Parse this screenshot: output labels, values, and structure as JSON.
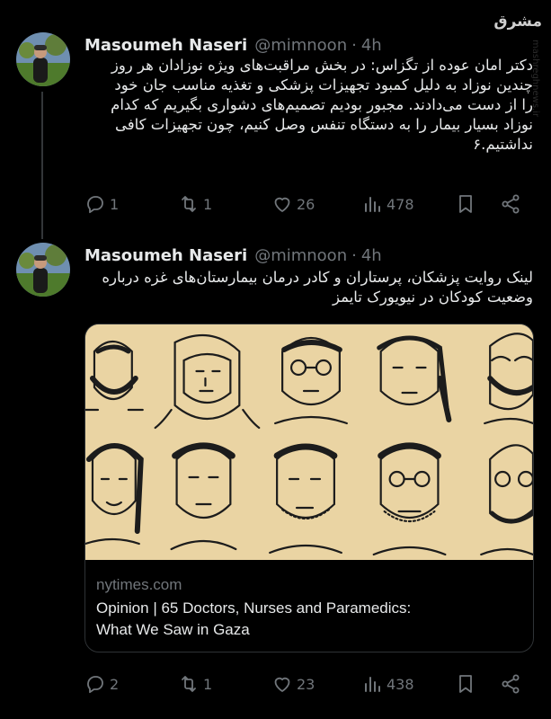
{
  "watermark": {
    "brand": "مشرق",
    "site": "mashreghnews.ir"
  },
  "tweets": [
    {
      "name": "Masoumeh Naseri",
      "handle": "@mimnoon",
      "dot": "·",
      "time": "4h",
      "lines": [
        "دکتر امان عوده از تگزاس: در بخش مراقبت‌های ویژه نوزادان هر روز",
        "چندین نوزاد به دلیل کمبود تجهیزات پزشکی و تغذیه مناسب جان خود",
        "را از دست می‌دادند. مجبور بودیم تصمیم‌های دشواری بگیریم که کدام",
        "نوزاد بسیار بیمار را به دستگاه تنفس وصل کنیم، چون تجهیزات کافی",
        "نداشتیم.۶"
      ],
      "reply_count": "1",
      "retweet_count": "1",
      "like_count": "26",
      "view_count": "478"
    },
    {
      "name": "Masoumeh Naseri",
      "handle": "@mimnoon",
      "dot": "·",
      "time": "4h",
      "lines": [
        "لینک روایت پزشکان، پرستاران و کادر درمان بیمارستان‌های غزه درباره",
        "وضعیت کودکان در نیویورک تایمز"
      ],
      "card": {
        "domain": "nytimes.com",
        "title_line1": "Opinion | 65 Doctors, Nurses and Paramedics:",
        "title_line2": "What We Saw in Gaza"
      },
      "reply_count": "2",
      "retweet_count": "1",
      "like_count": "23",
      "view_count": "438"
    }
  ],
  "colors": {
    "background": "#000000",
    "text": "#e7e9ea",
    "muted": "#71767b",
    "card_bg": "#ead4a3",
    "border": "#2f3336"
  },
  "icons": [
    "reply-icon",
    "retweet-icon",
    "like-icon",
    "views-icon",
    "bookmark-icon",
    "share-icon"
  ]
}
